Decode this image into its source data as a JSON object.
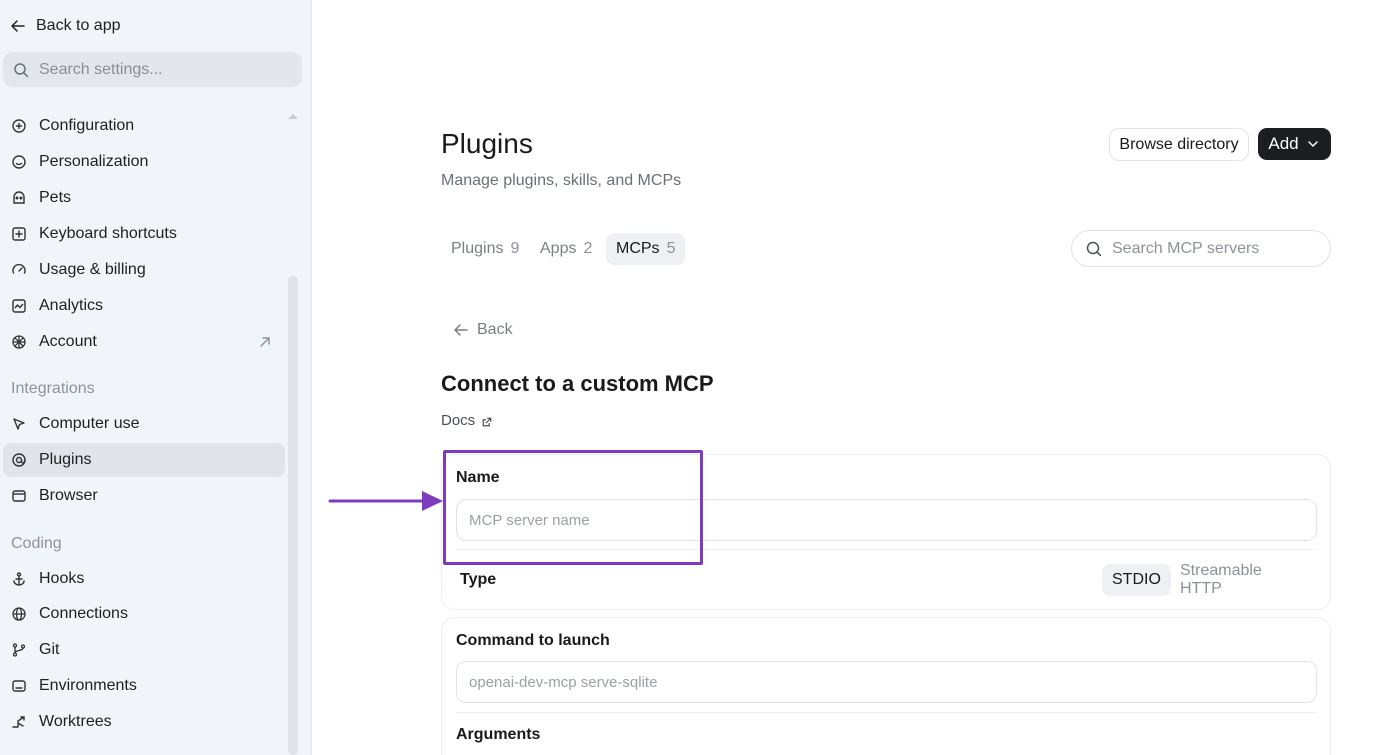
{
  "sidebar": {
    "back_label": "Back to app",
    "search_placeholder": "Search settings...",
    "items_top": [
      {
        "label": "Configuration",
        "icon": "configuration-icon"
      },
      {
        "label": "Personalization",
        "icon": "personalization-icon"
      },
      {
        "label": "Pets",
        "icon": "pets-icon"
      },
      {
        "label": "Keyboard shortcuts",
        "icon": "keyboard-icon"
      },
      {
        "label": "Usage & billing",
        "icon": "gauge-icon"
      },
      {
        "label": "Analytics",
        "icon": "analytics-icon"
      },
      {
        "label": "Account",
        "icon": "account-icon"
      }
    ],
    "section_integrations": "Integrations",
    "items_integrations": [
      {
        "label": "Computer use",
        "icon": "cursor-icon"
      },
      {
        "label": "Plugins",
        "icon": "plugin-icon",
        "active": true
      },
      {
        "label": "Browser",
        "icon": "browser-icon"
      }
    ],
    "section_coding": "Coding",
    "items_coding": [
      {
        "label": "Hooks",
        "icon": "hook-icon"
      },
      {
        "label": "Connections",
        "icon": "globe-icon"
      },
      {
        "label": "Git",
        "icon": "git-branch-icon"
      },
      {
        "label": "Environments",
        "icon": "environment-icon"
      },
      {
        "label": "Worktrees",
        "icon": "worktree-icon"
      }
    ]
  },
  "header": {
    "title": "Plugins",
    "subtitle": "Manage plugins, skills, and MCPs",
    "browse_label": "Browse directory",
    "add_label": "Add"
  },
  "tabs": [
    {
      "label": "Plugins",
      "count": "9"
    },
    {
      "label": "Apps",
      "count": "2"
    },
    {
      "label": "MCPs",
      "count": "5",
      "active": true
    }
  ],
  "search_mcp_placeholder": "Search MCP servers",
  "back_label": "Back",
  "form": {
    "title": "Connect to a custom MCP",
    "docs_label": "Docs",
    "name_label": "Name",
    "name_placeholder": "MCP server name",
    "type_label": "Type",
    "type_options": [
      "STDIO",
      "Streamable HTTP"
    ],
    "command_label": "Command to launch",
    "command_placeholder": "openai-dev-mcp serve-sqlite",
    "arguments_label": "Arguments"
  },
  "colors": {
    "annotation": "#7d3cbd",
    "sidebar_bg": "#f1f4f9",
    "primary_button": "#1b1d21"
  }
}
